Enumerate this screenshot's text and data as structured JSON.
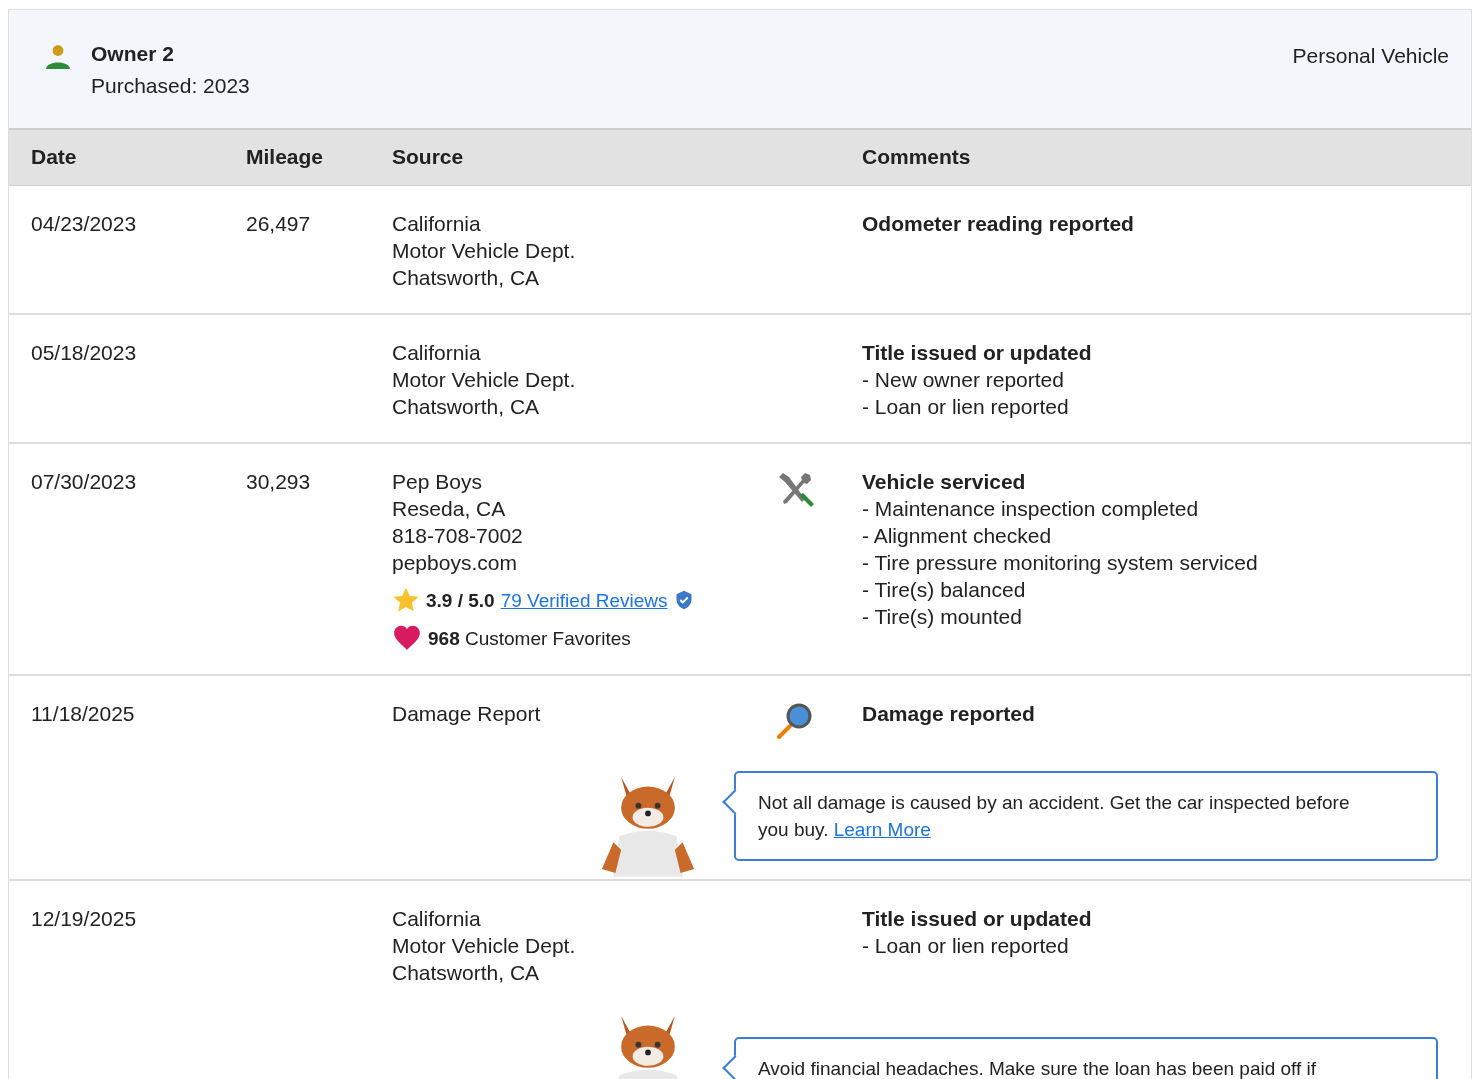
{
  "owner": {
    "title": "Owner 2",
    "purchased": "Purchased: 2023",
    "vehicle_type": "Personal Vehicle"
  },
  "table": {
    "columns": [
      "Date",
      "Mileage",
      "Source",
      "Comments"
    ],
    "rows": [
      {
        "date": "04/23/2023",
        "mileage": "26,497",
        "source": [
          "California",
          "Motor Vehicle Dept.",
          "Chatsworth, CA"
        ],
        "comment_title": "Odometer reading reported",
        "comment_items": []
      },
      {
        "date": "05/18/2023",
        "source": [
          "California",
          "Motor Vehicle Dept.",
          "Chatsworth, CA"
        ],
        "comment_title": "Title issued or updated",
        "comment_items": [
          "- New owner reported",
          "- Loan or lien reported"
        ]
      },
      {
        "date": "07/30/2023",
        "mileage": "30,293",
        "source": [
          "Pep Boys",
          "Reseda, CA",
          "818-708-7002",
          "pepboys.com"
        ],
        "rating": {
          "score": "3.9 / 5.0",
          "reviews_link": "79 Verified Reviews"
        },
        "favorites": {
          "count": "968",
          "label": "Customer Favorites"
        },
        "kind": "service",
        "comment_title": "Vehicle serviced",
        "comment_items": [
          "- Maintenance inspection completed",
          "- Alignment checked",
          "- Tire pressure monitoring system serviced",
          "- Tire(s) balanced",
          "- Tire(s) mounted"
        ]
      },
      {
        "date": "11/18/2025",
        "source": [
          "Damage Report"
        ],
        "kind": "damage",
        "comment_title": "Damage reported",
        "comment_items": [],
        "tip": {
          "text": "Not all damage is caused by an accident. Get the car inspected before you buy.",
          "link": "Learn More"
        }
      },
      {
        "date": "12/19/2025",
        "source": [
          "California",
          "Motor Vehicle Dept.",
          "Chatsworth, CA"
        ],
        "comment_title": "Title issued or updated",
        "comment_items": [
          "- Loan or lien reported"
        ],
        "tip": {
          "text": "Avoid financial headaches. Make sure the loan has been paid off if"
        }
      }
    ]
  }
}
